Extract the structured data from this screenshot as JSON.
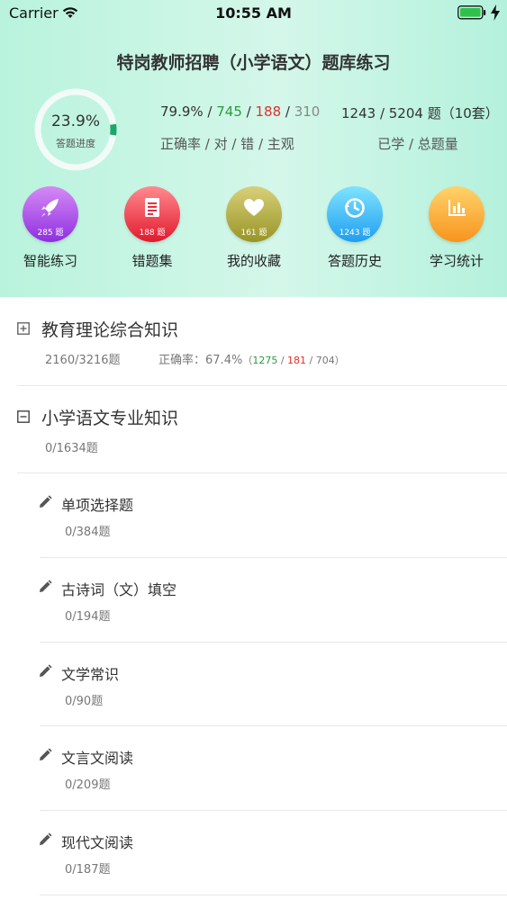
{
  "status_bar": {
    "carrier": "Carrier",
    "time": "10:55 AM"
  },
  "header": {
    "title": "特岗教师招聘（小学语文）题库练习",
    "progress": {
      "percent_text": "23.9%",
      "label": "答题进度",
      "value": 0.239
    },
    "accuracy": {
      "rate": "79.9%",
      "correct": "745",
      "wrong": "188",
      "subjective": "310",
      "sep": " / ",
      "label": "正确率 / 对 / 错 / 主观"
    },
    "learned": {
      "text": "1243 / 5204 题（10套）",
      "label": "已学 / 总题量"
    }
  },
  "shortcuts": [
    {
      "name": "smart-practice",
      "label": "智能练习",
      "count": "285 题",
      "icon": "rocket-icon",
      "color_top": "#d58af5",
      "color_bottom": "#8f2fe0"
    },
    {
      "name": "wrong-questions",
      "label": "错题集",
      "count": "188 题",
      "icon": "document-icon",
      "color_top": "#ff8a8f",
      "color_bottom": "#e2192c"
    },
    {
      "name": "my-favorites",
      "label": "我的收藏",
      "count": "161 题",
      "icon": "heart-icon",
      "color_top": "#d8d07a",
      "color_bottom": "#989526"
    },
    {
      "name": "answer-history",
      "label": "答题历史",
      "count": "1243 题",
      "icon": "history-icon",
      "color_top": "#7fe3ff",
      "color_bottom": "#1f9ef0"
    },
    {
      "name": "study-stats",
      "label": "学习统计",
      "count": "",
      "icon": "bar-chart-icon",
      "color_top": "#ffd36a",
      "color_bottom": "#f7941d"
    }
  ],
  "sections": [
    {
      "title": "教育理论综合知识",
      "progress": "2160/3216题",
      "accuracy": {
        "label": "正确率：",
        "rate": "67.4%",
        "open": "（",
        "correct": "1275",
        "wrong": "181",
        "subjective": "704",
        "close": "）",
        "sep": " / "
      },
      "expanded": false
    },
    {
      "title": "小学语文专业知识",
      "progress": "0/1634题",
      "expanded": true
    }
  ],
  "subsections": [
    {
      "title": "单项选择题",
      "progress": "0/384题"
    },
    {
      "title": "古诗词（文）填空",
      "progress": "0/194题"
    },
    {
      "title": "文学常识",
      "progress": "0/90题"
    },
    {
      "title": "文言文阅读",
      "progress": "0/209题"
    },
    {
      "title": "现代文阅读",
      "progress": "0/187题"
    }
  ]
}
